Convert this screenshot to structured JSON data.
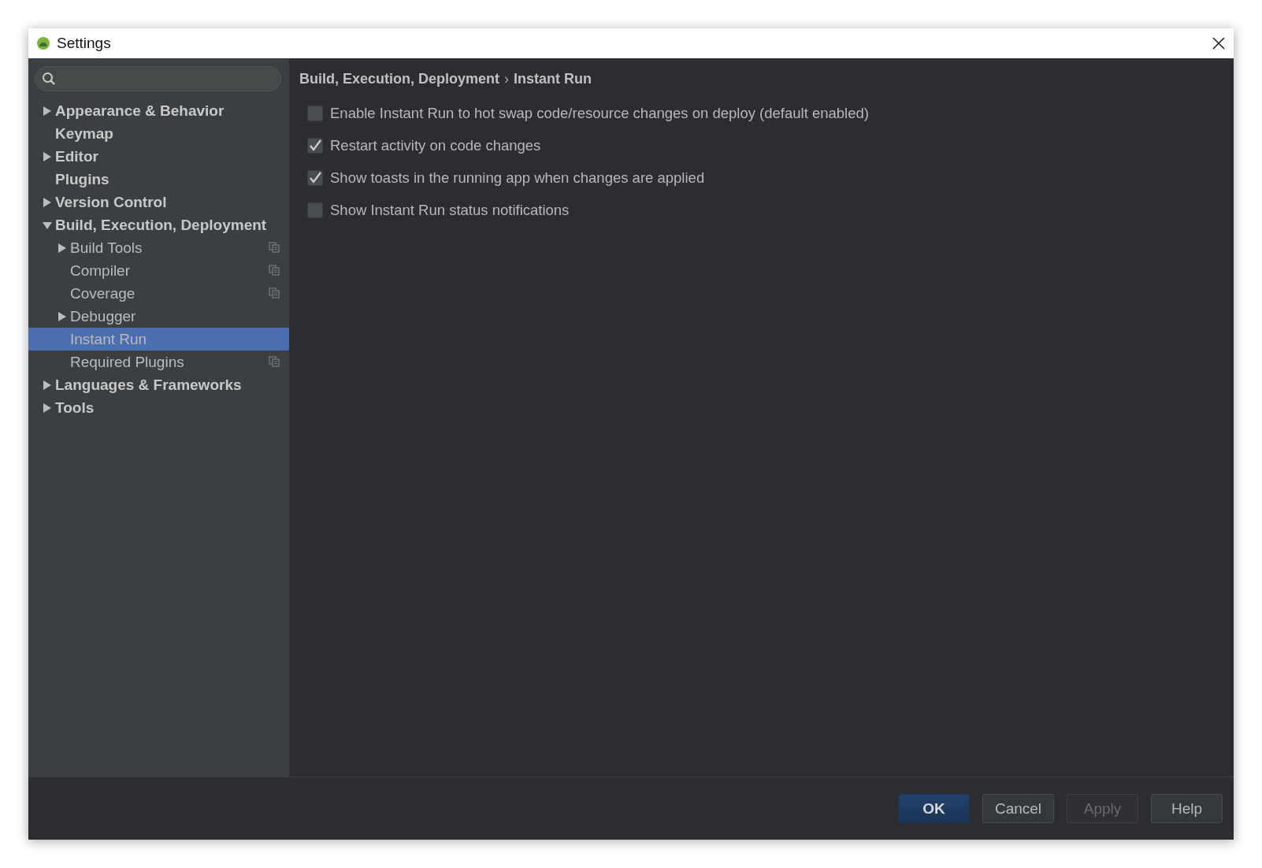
{
  "window": {
    "title": "Settings"
  },
  "sidebar": {
    "items": [
      {
        "label": "Appearance & Behavior",
        "expandable": true,
        "expanded": false,
        "selected": false,
        "project_level": false
      },
      {
        "label": "Keymap",
        "expandable": false,
        "expanded": false,
        "selected": false,
        "project_level": false
      },
      {
        "label": "Editor",
        "expandable": true,
        "expanded": false,
        "selected": false,
        "project_level": false
      },
      {
        "label": "Plugins",
        "expandable": false,
        "expanded": false,
        "selected": false,
        "project_level": false
      },
      {
        "label": "Version Control",
        "expandable": true,
        "expanded": false,
        "selected": false,
        "project_level": false
      },
      {
        "label": "Build, Execution, Deployment",
        "expandable": true,
        "expanded": true,
        "selected": false,
        "project_level": false,
        "children": [
          {
            "label": "Build Tools",
            "expandable": true,
            "expanded": false,
            "selected": false,
            "project_level": true
          },
          {
            "label": "Compiler",
            "expandable": false,
            "expanded": false,
            "selected": false,
            "project_level": true
          },
          {
            "label": "Coverage",
            "expandable": false,
            "expanded": false,
            "selected": false,
            "project_level": true
          },
          {
            "label": "Debugger",
            "expandable": true,
            "expanded": false,
            "selected": false,
            "project_level": false
          },
          {
            "label": "Instant Run",
            "expandable": false,
            "expanded": false,
            "selected": true,
            "project_level": false
          },
          {
            "label": "Required Plugins",
            "expandable": false,
            "expanded": false,
            "selected": false,
            "project_level": true
          }
        ]
      },
      {
        "label": "Languages & Frameworks",
        "expandable": true,
        "expanded": false,
        "selected": false,
        "project_level": false
      },
      {
        "label": "Tools",
        "expandable": true,
        "expanded": false,
        "selected": false,
        "project_level": false
      }
    ]
  },
  "breadcrumb": {
    "items": [
      "Build, Execution, Deployment",
      "Instant Run"
    ],
    "separator": "›"
  },
  "options": [
    {
      "label": "Enable Instant Run to hot swap code/resource changes on deploy (default enabled)",
      "checked": false
    },
    {
      "label": "Restart activity on code changes",
      "checked": true
    },
    {
      "label": "Show toasts in the running app when changes are applied",
      "checked": true
    },
    {
      "label": "Show Instant Run status notifications",
      "checked": false
    }
  ],
  "buttons": [
    {
      "label": "OK",
      "default": true,
      "disabled": false
    },
    {
      "label": "Cancel",
      "default": false,
      "disabled": false
    },
    {
      "label": "Apply",
      "default": false,
      "disabled": true
    },
    {
      "label": "Help",
      "default": false,
      "disabled": false
    }
  ]
}
